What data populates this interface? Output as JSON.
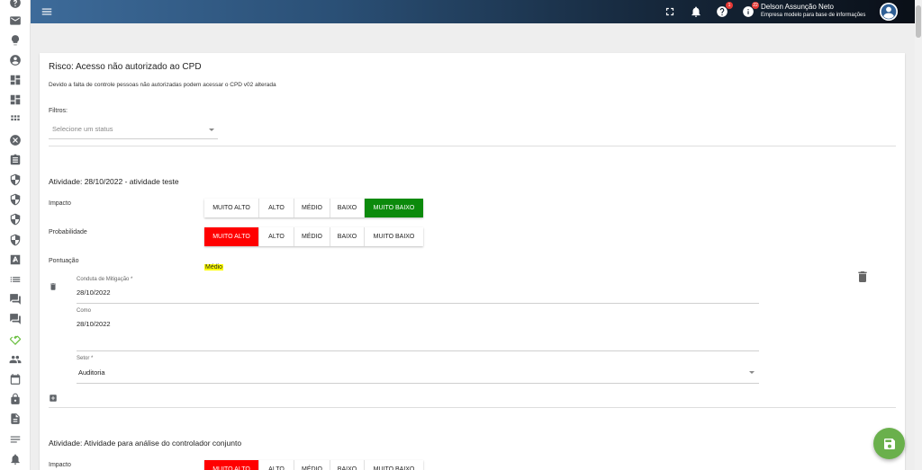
{
  "colors": {
    "accent": "#6ab04c",
    "selected_green": "#0c8a0c",
    "selected_red": "#ff0000",
    "highlight": "#ffff00"
  },
  "sidebar": {
    "icons": [
      "help-circle-icon",
      "mail-icon",
      "lightbulb-icon",
      "account-circle-icon",
      "dashboard-icon",
      "dashboard-icon",
      "apps-icon",
      "cancel-circle-icon",
      "clipboard-icon",
      "shield-icon",
      "shield-icon",
      "shield-icon",
      "shield-icon",
      "font-icon",
      "list-icon",
      "forum-icon",
      "forum-icon",
      "handshake-icon",
      "group-icon",
      "calendar-icon",
      "lock-icon",
      "file-icon",
      "notes-icon",
      "alert-bell-icon"
    ]
  },
  "header": {
    "user_name": "Delson Assunção Neto",
    "user_company": "Empresa modelo para base de informações",
    "help_badge": "1",
    "tutorial_badge": "22"
  },
  "risk": {
    "title": "Risco: Acesso não autorizado ao CPD",
    "description": "Devido a falta de controle pessoas não autorizadas podem acessar o CPD v02 alterada"
  },
  "filters": {
    "label": "Filtros:",
    "status_placeholder": "Selecione um status"
  },
  "activity1": {
    "title": "Atividade: 28/10/2022 - atividade teste",
    "impact_label": "Impacto",
    "probability_label": "Probabilidade",
    "score_label": "Pontuação",
    "score_value": "Médio",
    "levels": [
      "MUITO ALTO",
      "ALTO",
      "MÉDIO",
      "BAIXO",
      "MUITO BAIXO"
    ],
    "impact_selected": "MUITO BAIXO",
    "probability_selected": "MUITO ALTO",
    "mitigation_label": "Conduta de Mitigação *",
    "mitigation_value": "28/10/2022",
    "how_label": "Como",
    "how_value": "28/10/2022",
    "sector_label": "Setor *",
    "sector_value": "Auditoria"
  },
  "activity2": {
    "title": "Atividade: Atividade para análise do controlador conjunto",
    "impact_label": "Impacto",
    "levels": [
      "MUITO ALTO",
      "ALTO",
      "MÉDIO",
      "BAIXO",
      "MUITO BAIXO"
    ],
    "impact_selected": "MUITO ALTO"
  }
}
